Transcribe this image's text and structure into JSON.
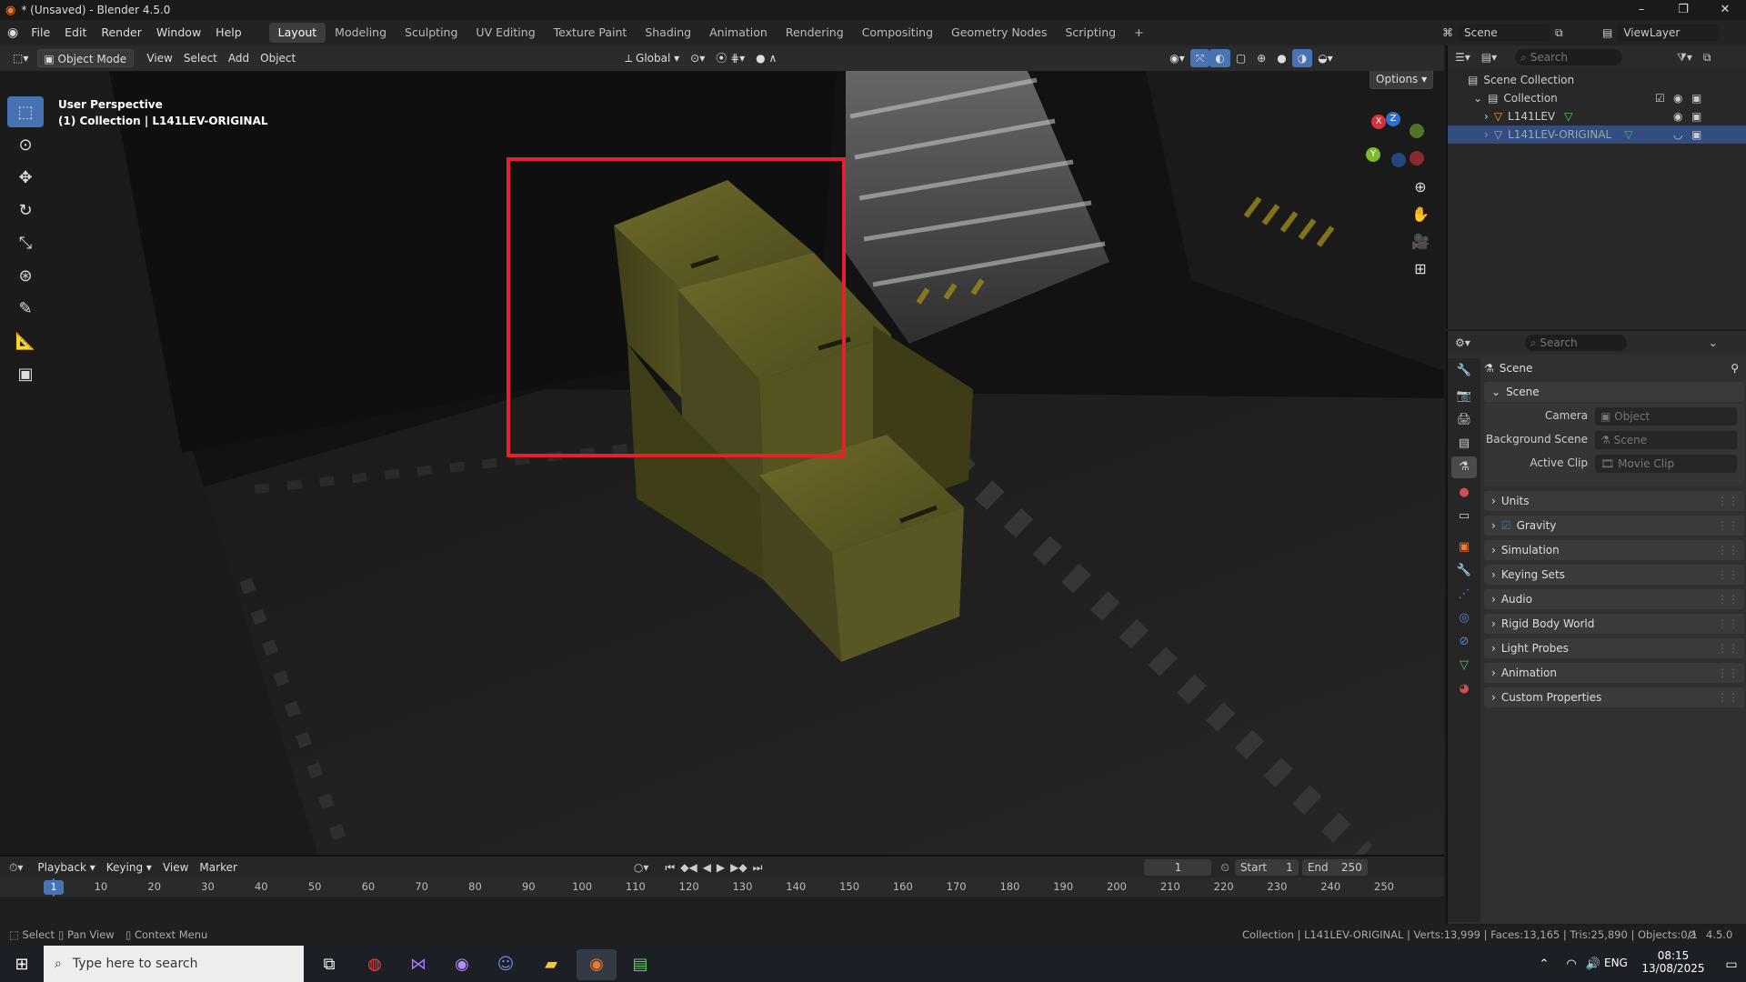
{
  "window": {
    "title": "* (Unsaved) - Blender 4.5.0",
    "minimize": "–",
    "maximize": "❐",
    "close": "✕"
  },
  "menu": {
    "items": [
      "File",
      "Edit",
      "Render",
      "Window",
      "Help"
    ]
  },
  "workspaces": {
    "tabs": [
      "Layout",
      "Modeling",
      "Sculpting",
      "UV Editing",
      "Texture Paint",
      "Shading",
      "Animation",
      "Rendering",
      "Compositing",
      "Geometry Nodes",
      "Scripting"
    ],
    "active": "Layout",
    "add": "+"
  },
  "scene": {
    "name": "Scene",
    "view_layer": "ViewLayer"
  },
  "viewport_header": {
    "mode": "Object Mode",
    "view": "View",
    "select": "Select",
    "add": "Add",
    "object": "Object",
    "transform": "Global",
    "options": "Options"
  },
  "viewport": {
    "perspective": "User Perspective",
    "collection_info": "(1) Collection | L141LEV-ORIGINAL",
    "gizmo": {
      "x": "X",
      "y": "Y",
      "z": "Z"
    }
  },
  "outliner": {
    "search_placeholder": "Search",
    "root": "Scene Collection",
    "collection": "Collection",
    "items": [
      "L141LEV",
      "L141LEV-ORIGINAL"
    ]
  },
  "properties": {
    "search_placeholder": "Search",
    "title": "Scene",
    "section": "Scene",
    "fields": [
      {
        "label": "Camera",
        "placeholder": "Object"
      },
      {
        "label": "Background Scene",
        "placeholder": "Scene"
      },
      {
        "label": "Active Clip",
        "placeholder": "Movie Clip"
      }
    ],
    "panels": [
      "Units",
      "Gravity",
      "Simulation",
      "Keying Sets",
      "Audio",
      "Rigid Body World",
      "Light Probes",
      "Animation",
      "Custom Properties"
    ],
    "gravity_checked": true
  },
  "timeline": {
    "playback": "Playback",
    "keying": "Keying",
    "view": "View",
    "marker": "Marker",
    "current_frame": "1",
    "start_label": "Start",
    "start": "1",
    "end_label": "End",
    "end": "250",
    "ticks": [
      "1",
      "10",
      "20",
      "30",
      "40",
      "50",
      "60",
      "70",
      "80",
      "90",
      "100",
      "110",
      "120",
      "130",
      "140",
      "150",
      "160",
      "170",
      "180",
      "190",
      "200",
      "210",
      "220",
      "230",
      "240",
      "250"
    ]
  },
  "statusbar": {
    "select": "Select",
    "pan": "Pan View",
    "context": "Context Menu",
    "stats": "Collection | L141LEV-ORIGINAL | Verts:13,999 | Faces:13,165 | Tris:25,890 | Objects:0/1",
    "version": "4.5.0"
  },
  "taskbar": {
    "search_placeholder": "Type here to search",
    "lang": "ENG",
    "time": "08:15",
    "date": "13/08/2025"
  },
  "colors": {
    "accent": "#4772b3",
    "highlight": "#e8202a",
    "active_row": "#334d80",
    "cube": "#5c5a1d"
  }
}
